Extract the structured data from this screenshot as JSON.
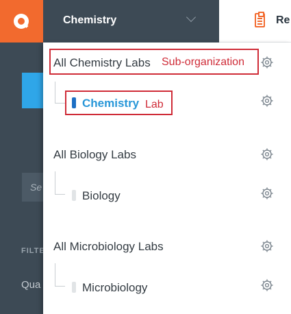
{
  "header": {
    "org_selector": "Chemistry",
    "reports_label": "Re"
  },
  "sidebar": {
    "search_placeholder": "Se",
    "filter_label": "FILTE",
    "quality_label": "Qua"
  },
  "dropdown": {
    "organizations": [
      {
        "name": "All Chemistry Labs",
        "labs": [
          {
            "name": "Chemistry",
            "active": true
          }
        ]
      },
      {
        "name": "All Biology Labs",
        "labs": [
          {
            "name": "Biology",
            "active": false
          }
        ]
      },
      {
        "name": "All Microbiology Labs",
        "labs": [
          {
            "name": "Microbiology",
            "active": false
          }
        ]
      }
    ]
  },
  "annotations": {
    "sub_organization": "Sub-organization",
    "lab": "Lab"
  },
  "colors": {
    "accent": "#f26a2e",
    "annotation": "#cf2b37",
    "active_lab": "#2897d8"
  }
}
